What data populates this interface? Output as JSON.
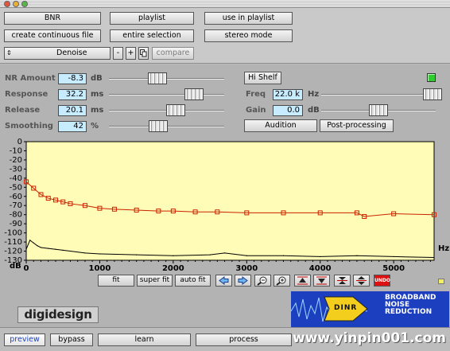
{
  "toolbar": {
    "row1": [
      "BNR",
      "playlist",
      "use in playlist"
    ],
    "row2": [
      "create continuous file",
      "entire selection",
      "stereo mode"
    ],
    "preset": "Denoise",
    "minus": "-",
    "plus": "+",
    "compare": "compare"
  },
  "params_left": [
    {
      "label": "NR Amount",
      "value": "-8.3",
      "unit": "dB",
      "level": 0.42
    },
    {
      "label": "Response",
      "value": "32.2",
      "unit": "ms",
      "level": 0.74
    },
    {
      "label": "Release",
      "value": "20.1",
      "unit": "ms",
      "level": 0.58
    },
    {
      "label": "Smoothing",
      "value": "42",
      "unit": "%",
      "level": 0.43
    }
  ],
  "params_right": [
    {
      "label": "Freq",
      "value": "22.0 k",
      "unit": "Hz",
      "level": 0.97
    },
    {
      "label": "Gain",
      "value": "0.0",
      "unit": "dB",
      "level": 0.5
    }
  ],
  "buttons": {
    "hi_shelf": "Hi Shelf",
    "audition": "Audition",
    "post_processing": "Post-processing",
    "fit": "fit",
    "super_fit": "super fit",
    "auto_fit": "auto fit",
    "undo": "UNDO"
  },
  "colors": {
    "plot_bg": "#fefcb6",
    "threshold_line": "#cc2200",
    "noise_line": "#000000",
    "value_field": "#c7ecff",
    "status_led": "#2ecc2e"
  },
  "chart_data": {
    "type": "line",
    "xlabel": "Hz",
    "ylabel": "dB",
    "xlim": [
      0,
      5550
    ],
    "ylim": [
      -130,
      0
    ],
    "x_ticks": [
      "0",
      "1000",
      "2000",
      "3000",
      "4000",
      "5000"
    ],
    "y_ticks": [
      "0",
      "-10",
      "-20",
      "-30",
      "-40",
      "-50",
      "-60",
      "-70",
      "-80",
      "-90",
      "-100",
      "-110",
      "-120",
      "-130"
    ],
    "series": [
      {
        "marker": "square",
        "x": [
          0,
          100,
          200,
          300,
          400,
          500,
          600,
          800,
          1000,
          1200,
          1500,
          1800,
          2000,
          2300,
          2600,
          3000,
          3500,
          4000,
          4500,
          4600,
          5000,
          5550
        ],
        "values": [
          -44,
          -51,
          -58,
          -62,
          -64,
          -66,
          -68,
          -70,
          -73,
          -74,
          -75,
          -76,
          -76,
          -77,
          -77,
          -78,
          -78,
          -78,
          -78,
          -82,
          -79,
          -80
        ]
      },
      {
        "x": [
          0,
          50,
          100,
          150,
          200,
          300,
          400,
          500,
          600,
          800,
          1000,
          1500,
          2000,
          2500,
          2700,
          3000,
          3500,
          4000,
          4500,
          5000,
          5550
        ],
        "values": [
          -118,
          -108,
          -111,
          -114,
          -116,
          -117,
          -118,
          -119,
          -120,
          -122,
          -123,
          -124,
          -125,
          -124,
          -122,
          -125,
          -125,
          -126,
          -125,
          -126,
          -127
        ]
      }
    ]
  },
  "footer": {
    "logo": "digidesign",
    "banner_brand": "DINR",
    "banner_line1": "BROADBAND",
    "banner_line2": "NOISE",
    "banner_line3": "REDUCTION",
    "watermark": "www.yinpin001.com",
    "tabs": [
      "preview",
      "bypass",
      "learn",
      "process"
    ]
  }
}
